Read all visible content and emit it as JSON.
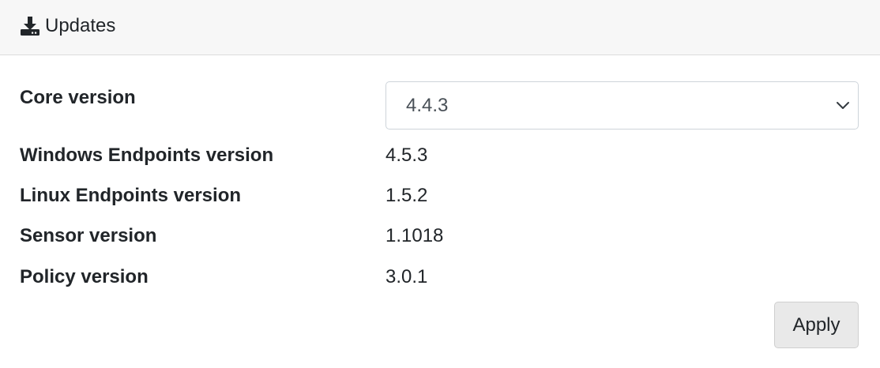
{
  "header": {
    "icon": "download-icon",
    "title": "Updates"
  },
  "rows": [
    {
      "label": "Core version",
      "value": "4.4.3",
      "control": "select"
    },
    {
      "label": "Windows Endpoints version",
      "value": "4.5.3"
    },
    {
      "label": "Linux Endpoints version",
      "value": "1.5.2"
    },
    {
      "label": "Sensor version",
      "value": "1.1018"
    },
    {
      "label": "Policy version",
      "value": "3.0.1"
    }
  ],
  "actions": {
    "apply_label": "Apply"
  },
  "colors": {
    "header_bg": "#f7f7f7",
    "button_bg": "#e9e9e9",
    "text": "#212529"
  }
}
